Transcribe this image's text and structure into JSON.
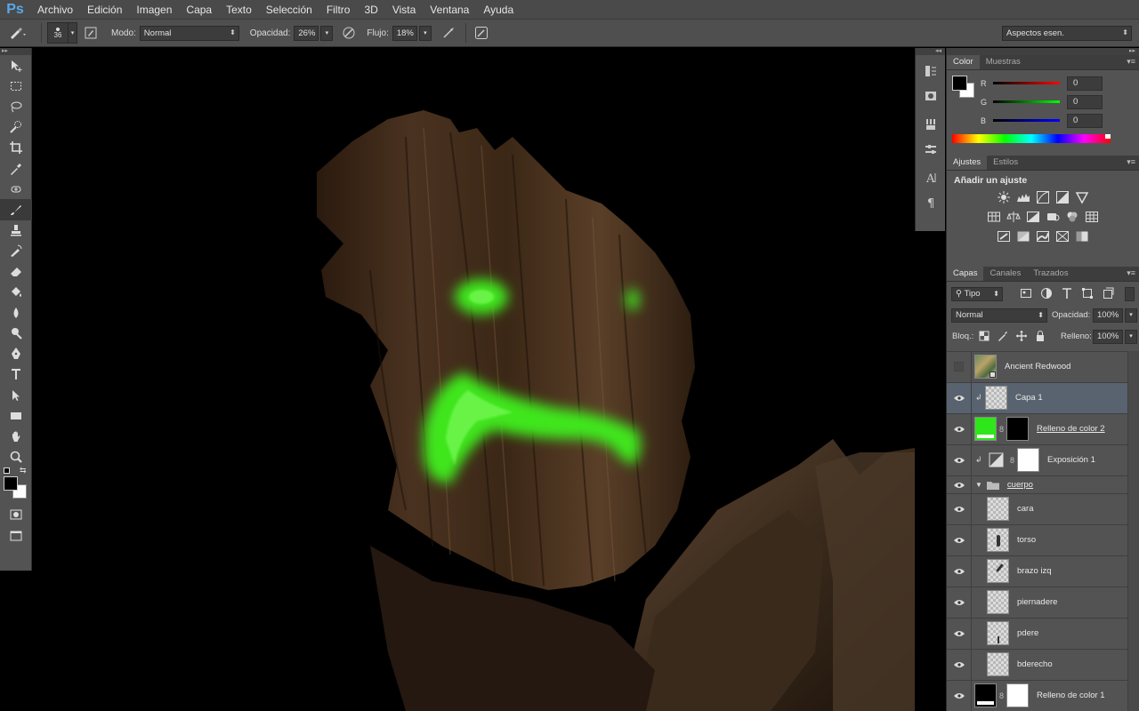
{
  "app": {
    "logo": "Ps"
  },
  "menu": [
    "Archivo",
    "Edición",
    "Imagen",
    "Capa",
    "Texto",
    "Selección",
    "Filtro",
    "3D",
    "Vista",
    "Ventana",
    "Ayuda"
  ],
  "options": {
    "brush_size": "36",
    "mode_label": "Modo:",
    "mode_value": "Normal",
    "opacity_label": "Opacidad:",
    "opacity_value": "26%",
    "flow_label": "Flujo:",
    "flow_value": "18%",
    "workspace": "Aspectos esen."
  },
  "color_panel": {
    "tabs": [
      "Color",
      "Muestras"
    ],
    "r_label": "R",
    "r_value": "0",
    "g_label": "G",
    "g_value": "0",
    "b_label": "B",
    "b_value": "0",
    "foreground": "#000000",
    "background": "#ffffff"
  },
  "adjust_panel": {
    "tabs": [
      "Ajustes",
      "Estilos"
    ],
    "title": "Añadir un ajuste"
  },
  "layers_panel": {
    "tabs": [
      "Capas",
      "Canales",
      "Trazados"
    ],
    "filter_kind": "Tipo",
    "blend_mode": "Normal",
    "opacity_label": "Opacidad:",
    "opacity_value": "100%",
    "lock_label": "Bloq.:",
    "fill_label": "Relleno:",
    "fill_value": "100%",
    "layers": [
      {
        "name": "Ancient Redwood",
        "visible": false,
        "thumb": "image"
      },
      {
        "name": "Capa 1",
        "visible": true,
        "thumb": "transparent",
        "selected": true,
        "clipped": true
      },
      {
        "name": "Relleno de color 2",
        "visible": true,
        "thumb": "fill",
        "fill_color": "#2ee61a",
        "mask": "#000000",
        "underline": true
      },
      {
        "name": "Exposición 1",
        "visible": true,
        "thumb": "adjustment",
        "mask": "#ffffff",
        "clipped": true
      },
      {
        "name": "cuerpo",
        "visible": true,
        "thumb": "group",
        "underline": true
      },
      {
        "name": "cara",
        "visible": true,
        "thumb": "transparent"
      },
      {
        "name": "torso",
        "visible": true,
        "thumb": "transparent"
      },
      {
        "name": "brazo izq",
        "visible": true,
        "thumb": "transparent"
      },
      {
        "name": "piernadere",
        "visible": true,
        "thumb": "transparent"
      },
      {
        "name": "pdere",
        "visible": true,
        "thumb": "transparent"
      },
      {
        "name": "bderecho",
        "visible": true,
        "thumb": "transparent"
      },
      {
        "name": "Relleno de color 1",
        "visible": true,
        "thumb": "fill",
        "fill_color": "#000000",
        "mask": "#ffffff"
      }
    ]
  },
  "accent": "#58636f",
  "glow_color": "#3fe61f"
}
